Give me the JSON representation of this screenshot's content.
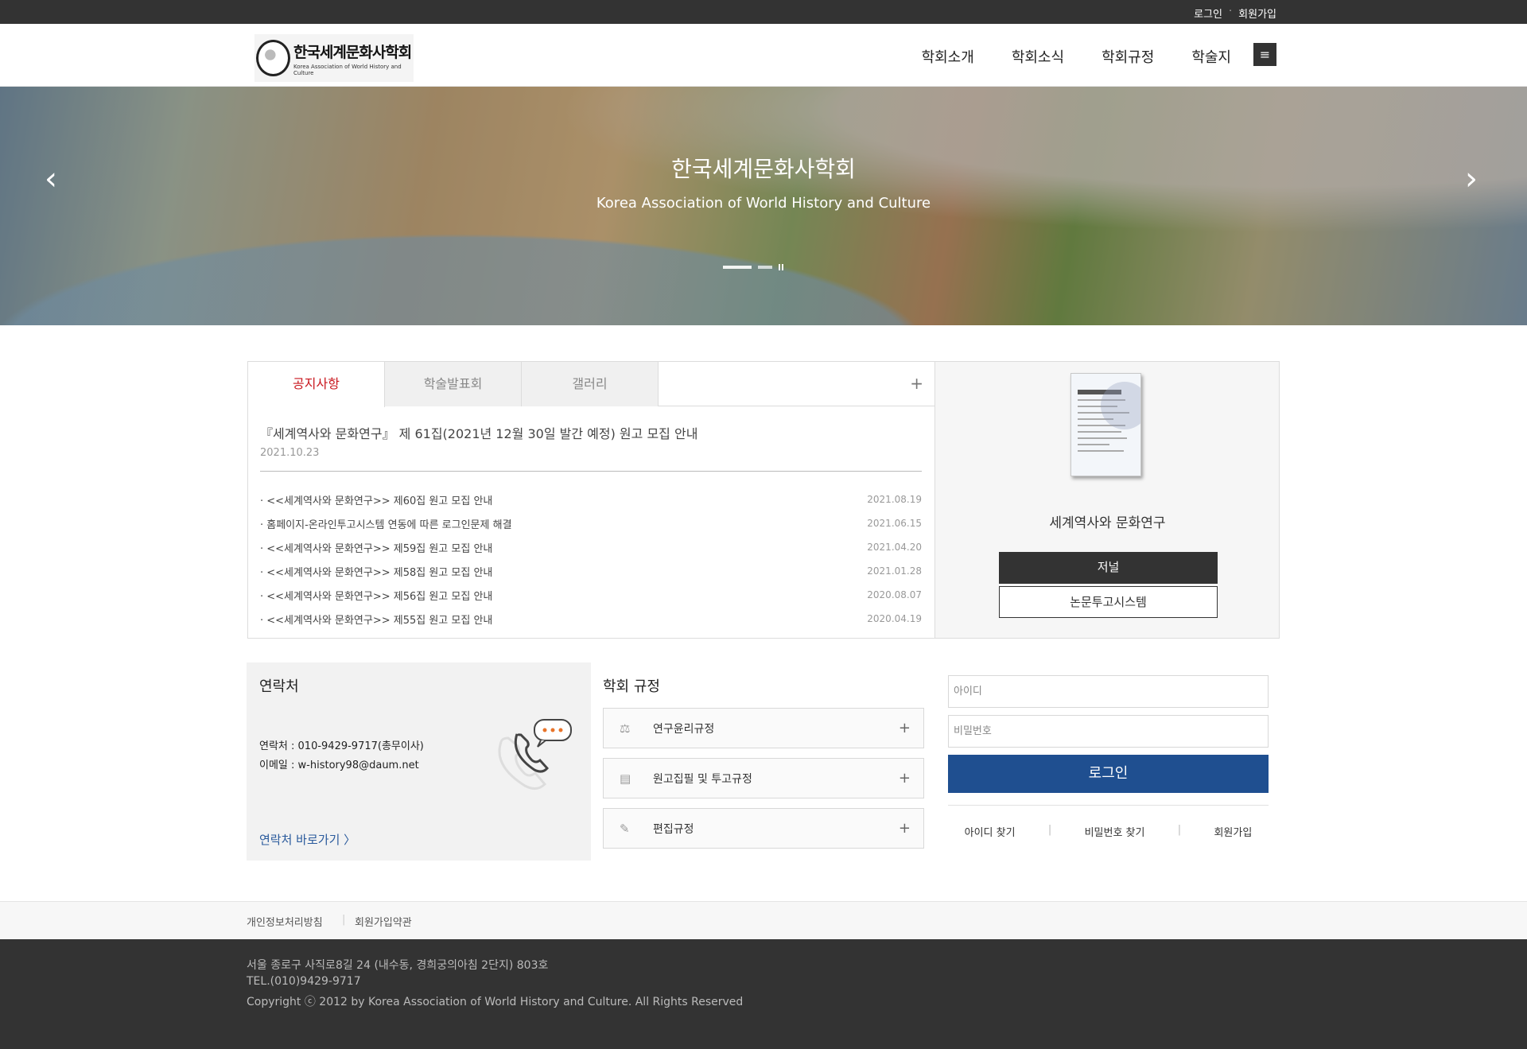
{
  "topbar": {
    "login": "로그인",
    "separator": "·",
    "signup": "회원가입"
  },
  "logo": {
    "title": "한국세계문화사학회",
    "subtitle": "Korea Association of World History and Culture"
  },
  "nav": [
    "학회소개",
    "학회소식",
    "학회규정",
    "학술지"
  ],
  "hero": {
    "title": "한국세계문화사학회",
    "subtitle": "Korea Association of World History and Culture"
  },
  "notice": {
    "tabs": [
      "공지사항",
      "학술발표회",
      "갤러리"
    ],
    "more": "+",
    "feature": {
      "title": "『세계역사와 문화연구』 제 61집(2021년 12월 30일 발간 예정) 원고 모집 안내",
      "date": "2021.10.23"
    },
    "items": [
      {
        "title": "· <<세계역사와 문화연구>> 제60집 원고 모집 안내",
        "date": "2021.08.19"
      },
      {
        "title": "· 홈페이지-온라인투고시스템 연동에 따른 로그인문제 해결",
        "date": "2021.06.15"
      },
      {
        "title": "· <<세계역사와 문화연구>> 제59집 원고 모집 안내",
        "date": "2021.04.20"
      },
      {
        "title": "· <<세계역사와 문화연구>> 제58집 원고 모집 안내",
        "date": "2021.01.28"
      },
      {
        "title": "· <<세계역사와 문화연구>> 제56집 원고 모집 안내",
        "date": "2020.08.07"
      },
      {
        "title": "· <<세계역사와 문화연구>> 제55집 원고 모집 안내",
        "date": "2020.04.19"
      }
    ]
  },
  "journal": {
    "name": "세계역사와 문화연구",
    "button_journal": "저널",
    "button_submit": "논문투고시스템"
  },
  "contact": {
    "heading": "연락처",
    "phone": "연락처 : 010-9429-9717(총무이사)",
    "email": "이메일 : w-history98@daum.net",
    "link": "연락처 바로가기   〉"
  },
  "rules": {
    "heading": "학회 규정",
    "items": [
      {
        "label": "연구윤리규정",
        "icon": "scale-icon"
      },
      {
        "label": "원고집필 및 투고규정",
        "icon": "document-icon"
      },
      {
        "label": "편집규정",
        "icon": "pencil-icon"
      }
    ],
    "plus": "+"
  },
  "login": {
    "id_placeholder": "아이디",
    "pw_placeholder": "비밀번호",
    "button": "로그인",
    "find_id": "아이디 찾기",
    "find_pw": "비밀번호 찾기",
    "signup": "회원가입",
    "pipe": "|"
  },
  "footer_links": {
    "privacy": "개인정보처리방침",
    "bar": "|",
    "terms": "회원가입약관"
  },
  "footer": {
    "address": "서울 종로구 사직로8길 24 (내수동, 경희궁의아침 2단지) 803호",
    "tel": "TEL.(010)9429-9717",
    "copyright": "Copyright ⓒ 2012 by Korea Association of World History and Culture. All Rights Reserved"
  },
  "colors": {
    "topbar": "#333333",
    "accent_red": "#c9171e",
    "login_blue": "#1f4f90",
    "link_blue": "#2a5a9c",
    "footer": "#333333"
  }
}
